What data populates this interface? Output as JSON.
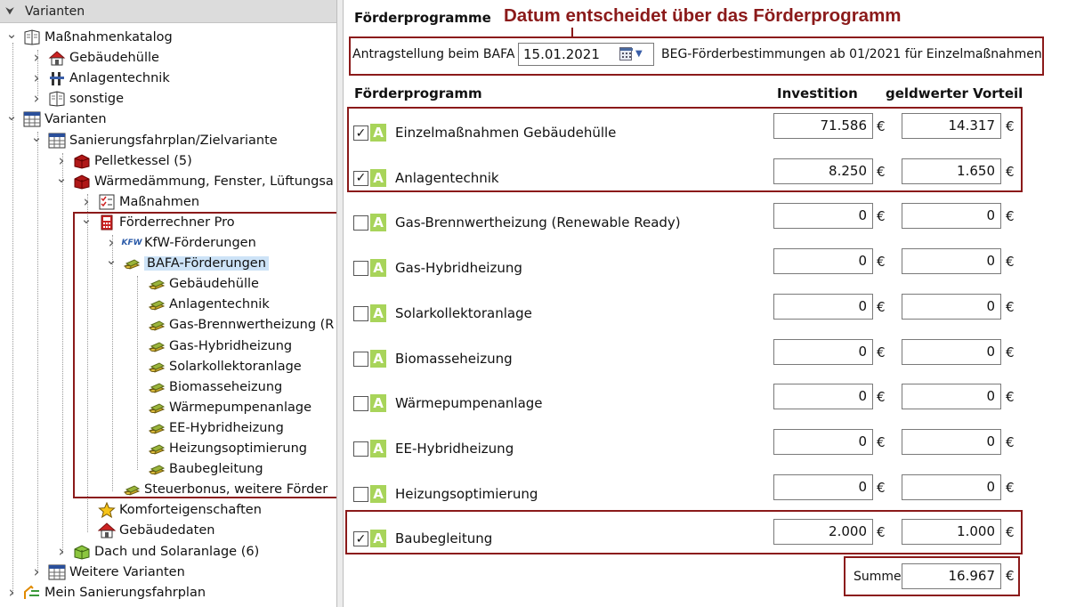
{
  "tree": {
    "header": "Varianten",
    "items": [
      {
        "label": "Maßnahmenkatalog"
      },
      {
        "label": "Gebäudehülle"
      },
      {
        "label": "Anlagentechnik"
      },
      {
        "label": "sonstige"
      },
      {
        "label": "Varianten"
      },
      {
        "label": "Sanierungsfahrplan/Zielvariante"
      },
      {
        "label": "Pelletkessel (5)"
      },
      {
        "label": "Wärmedämmung, Fenster, Lüftungsa"
      },
      {
        "label": "Maßnahmen"
      },
      {
        "label": "Förderrechner Pro"
      },
      {
        "label": "KfW-Förderungen",
        "badge": "KFW"
      },
      {
        "label": "BAFA-Förderungen"
      },
      {
        "label": "Gebäudehülle"
      },
      {
        "label": "Anlagentechnik"
      },
      {
        "label": "Gas-Brennwertheizung (R"
      },
      {
        "label": "Gas-Hybridheizung"
      },
      {
        "label": "Solarkollektoranlage"
      },
      {
        "label": "Biomasseheizung"
      },
      {
        "label": "Wärmepumpenanlage"
      },
      {
        "label": "EE-Hybridheizung"
      },
      {
        "label": "Heizungsoptimierung"
      },
      {
        "label": "Baubegleitung"
      },
      {
        "label": "Steuerbonus, weitere Förder"
      },
      {
        "label": "Komforteigenschaften"
      },
      {
        "label": "Gebäudedaten"
      },
      {
        "label": "Dach und Solaranlage (6)"
      },
      {
        "label": "Weitere Varianten"
      },
      {
        "label": "Mein Sanierungsfahrplan"
      }
    ]
  },
  "main": {
    "section_title": "Förderprogramme",
    "annotation": "Datum entscheidet über das Förderprogramm",
    "antrag_label": "Antragstellung beim BAFA",
    "antrag_date": "15.01.2021",
    "beg_text": "BEG-Förderbestimmungen ab 01/2021 für Einzelmaßnahmen",
    "col_program": "Förderprogramm",
    "col_invest": "Investition",
    "col_benefit": "geldwerter Vorteil",
    "badge_letter": "A",
    "currency": "€",
    "checkmark": "✓",
    "programs": [
      {
        "name": "Einzelmaßnahmen Gebäudehülle",
        "checked": true,
        "investition": "71.586",
        "vorteil": "14.317"
      },
      {
        "name": "Anlagentechnik",
        "checked": true,
        "investition": "8.250",
        "vorteil": "1.650"
      },
      {
        "name": "Gas-Brennwertheizung (Renewable Ready)",
        "checked": false,
        "investition": "0",
        "vorteil": "0"
      },
      {
        "name": "Gas-Hybridheizung",
        "checked": false,
        "investition": "0",
        "vorteil": "0"
      },
      {
        "name": "Solarkollektoranlage",
        "checked": false,
        "investition": "0",
        "vorteil": "0"
      },
      {
        "name": "Biomasseheizung",
        "checked": false,
        "investition": "0",
        "vorteil": "0"
      },
      {
        "name": "Wärmepumpenanlage",
        "checked": false,
        "investition": "0",
        "vorteil": "0"
      },
      {
        "name": "EE-Hybridheizung",
        "checked": false,
        "investition": "0",
        "vorteil": "0"
      },
      {
        "name": "Heizungsoptimierung",
        "checked": false,
        "investition": "0",
        "vorteil": "0"
      },
      {
        "name": "Baubegleitung",
        "checked": true,
        "investition": "2.000",
        "vorteil": "1.000"
      }
    ],
    "summe_label": "Summe",
    "summe_value": "16.967"
  },
  "colors": {
    "annotation": "#8b1a1a",
    "badge": "#a8d45a",
    "selection": "#cde3f7"
  }
}
